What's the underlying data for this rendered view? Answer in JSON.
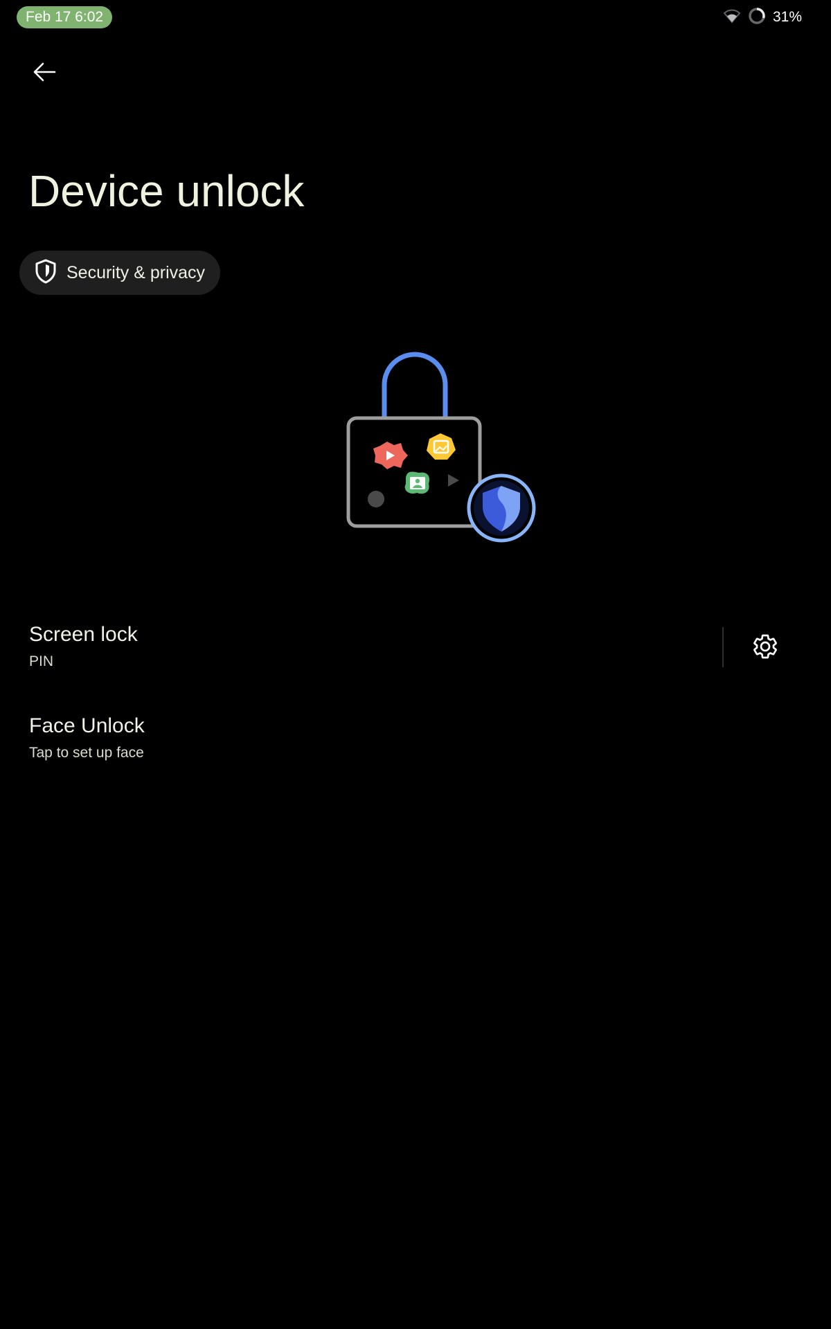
{
  "status_bar": {
    "time": "Feb 17 6:02",
    "battery": "31%",
    "icons": [
      "wifi-icon",
      "battery-ring-icon"
    ],
    "clock_pill_color": "#7fb36f"
  },
  "header": {
    "back_icon": "arrow-back-icon",
    "title": "Device unlock"
  },
  "breadcrumb": {
    "icon": "shield-icon",
    "label": "Security & privacy"
  },
  "illustration": {
    "description_icons": [
      "lock-icon",
      "play-badge-icon",
      "image-badge-icon",
      "contact-badge-icon",
      "shield-badge-icon"
    ],
    "colors": {
      "lock_shackle": "#5b8def",
      "lock_body": "#9e9e9e",
      "play_badge": "#ee675c",
      "image_badge": "#fcc934",
      "contact_badge": "#5bb974",
      "shield_ring": "#8ab4f8",
      "shield_fill": "#3b5bdb"
    }
  },
  "preferences": [
    {
      "title": "Screen lock",
      "summary": "PIN",
      "action_icon": "gear-icon"
    },
    {
      "title": "Face Unlock",
      "summary": "Tap to set up face"
    }
  ],
  "theme": {
    "background": "#000000",
    "title_color": "#eef3df",
    "chip_background": "#1f1f1f"
  }
}
